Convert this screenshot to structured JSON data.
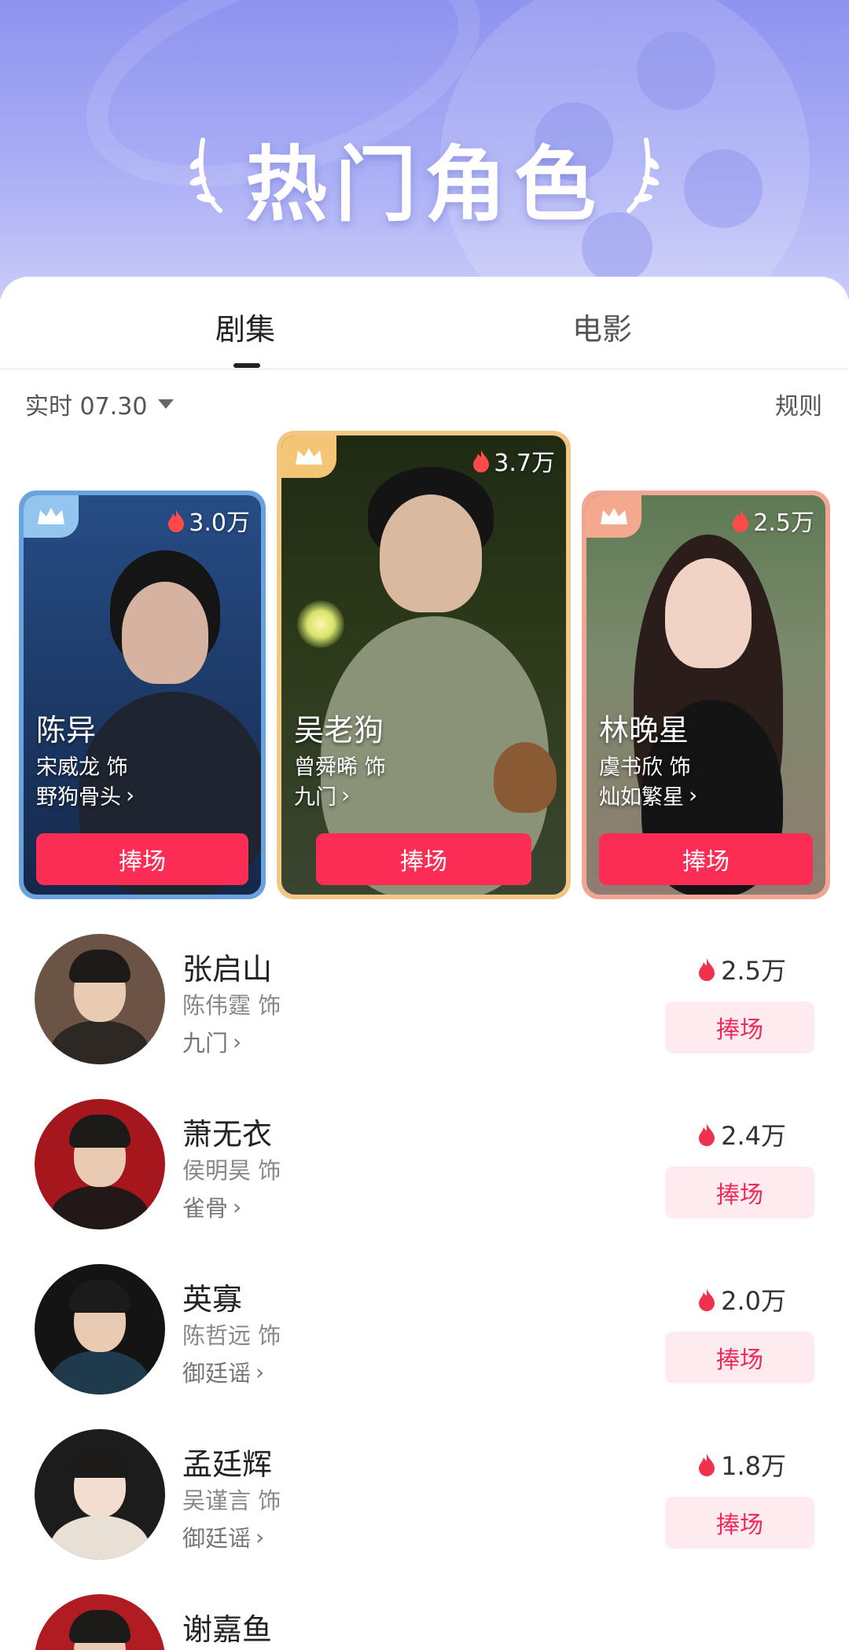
{
  "banner": {
    "title": "热门角色"
  },
  "tabs": [
    {
      "label": "剧集"
    },
    {
      "label": "电影"
    }
  ],
  "filter": {
    "label": "实时 07.30"
  },
  "rules_label": "规则",
  "button_label": "捧场",
  "top_cards": [
    {
      "heat": "3.0万",
      "name": "陈异",
      "actor": "宋威龙 饰",
      "show": "野狗骨头",
      "frame_color": "#6aa2de",
      "badge_color": "#93c5ee"
    },
    {
      "heat": "3.7万",
      "name": "吴老狗",
      "actor": "曾舜晞 饰",
      "show": "九门",
      "frame_color": "#f2c784",
      "badge_color": "#f3c574"
    },
    {
      "heat": "2.5万",
      "name": "林晚星",
      "actor": "虞书欣 饰",
      "show": "灿如繁星",
      "frame_color": "#f0a595",
      "badge_color": "#f4a98e"
    }
  ],
  "list": [
    {
      "name": "张启山",
      "actor": "陈伟霆 饰",
      "show": "九门",
      "heat": "2.5万"
    },
    {
      "name": "萧无衣",
      "actor": "侯明昊 饰",
      "show": "雀骨",
      "heat": "2.4万"
    },
    {
      "name": "英寡",
      "actor": "陈哲远 饰",
      "show": "御廷谣",
      "heat": "2.0万"
    },
    {
      "name": "孟廷辉",
      "actor": "吴谨言 饰",
      "show": "御廷谣",
      "heat": "1.8万"
    },
    {
      "name": "谢嘉鱼"
    }
  ]
}
